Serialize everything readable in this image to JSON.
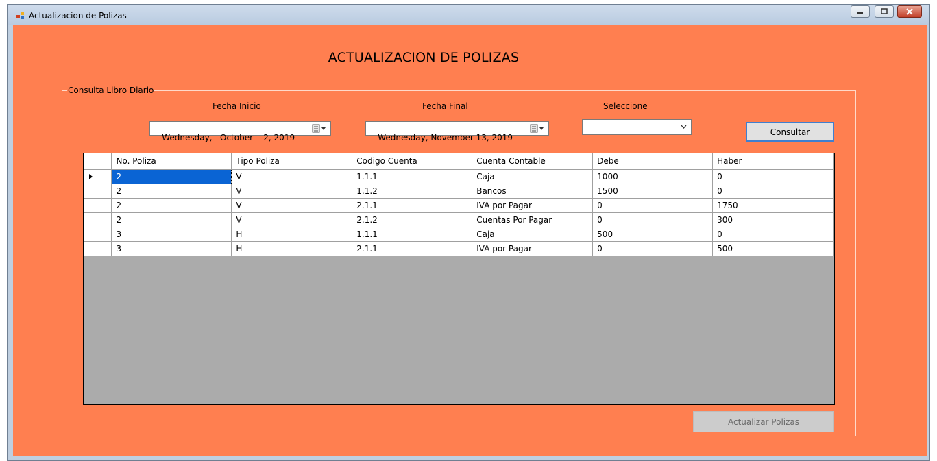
{
  "window": {
    "title": "Actualizacion de Polizas",
    "client_color": "#ff7f50"
  },
  "heading": "ACTUALIZACION DE POLIZAS",
  "group": {
    "label": "Consulta Libro Diario"
  },
  "filters": {
    "start_label": "Fecha Inicio",
    "start_value": "Wednesday,   October    2, 2019",
    "end_label": "Fecha Final",
    "end_value": "Wednesday, November 13, 2019",
    "select_label": "Seleccione",
    "select_value": ""
  },
  "buttons": {
    "consultar": "Consultar",
    "actualizar": "Actualizar Polizas"
  },
  "grid": {
    "columns": [
      "No. Poliza",
      "Tipo Poliza",
      "Codigo Cuenta",
      "Cuenta Contable",
      "Debe",
      "Haber"
    ],
    "rows": [
      [
        "2",
        "V",
        "1.1.1",
        "Caja",
        "1000",
        "0"
      ],
      [
        "2",
        "V",
        "1.1.2",
        "Bancos",
        "1500",
        "0"
      ],
      [
        "2",
        "V",
        "2.1.1",
        "IVA por Pagar",
        "0",
        "1750"
      ],
      [
        "2",
        "V",
        "2.1.2",
        "Cuentas Por Pagar",
        "0",
        "300"
      ],
      [
        "3",
        "H",
        "1.1.1",
        "Caja",
        "500",
        "0"
      ],
      [
        "3",
        "H",
        "2.1.1",
        "IVA por Pagar",
        "0",
        "500"
      ]
    ],
    "selected_row": 0,
    "selected_color": "#0a64d4"
  }
}
